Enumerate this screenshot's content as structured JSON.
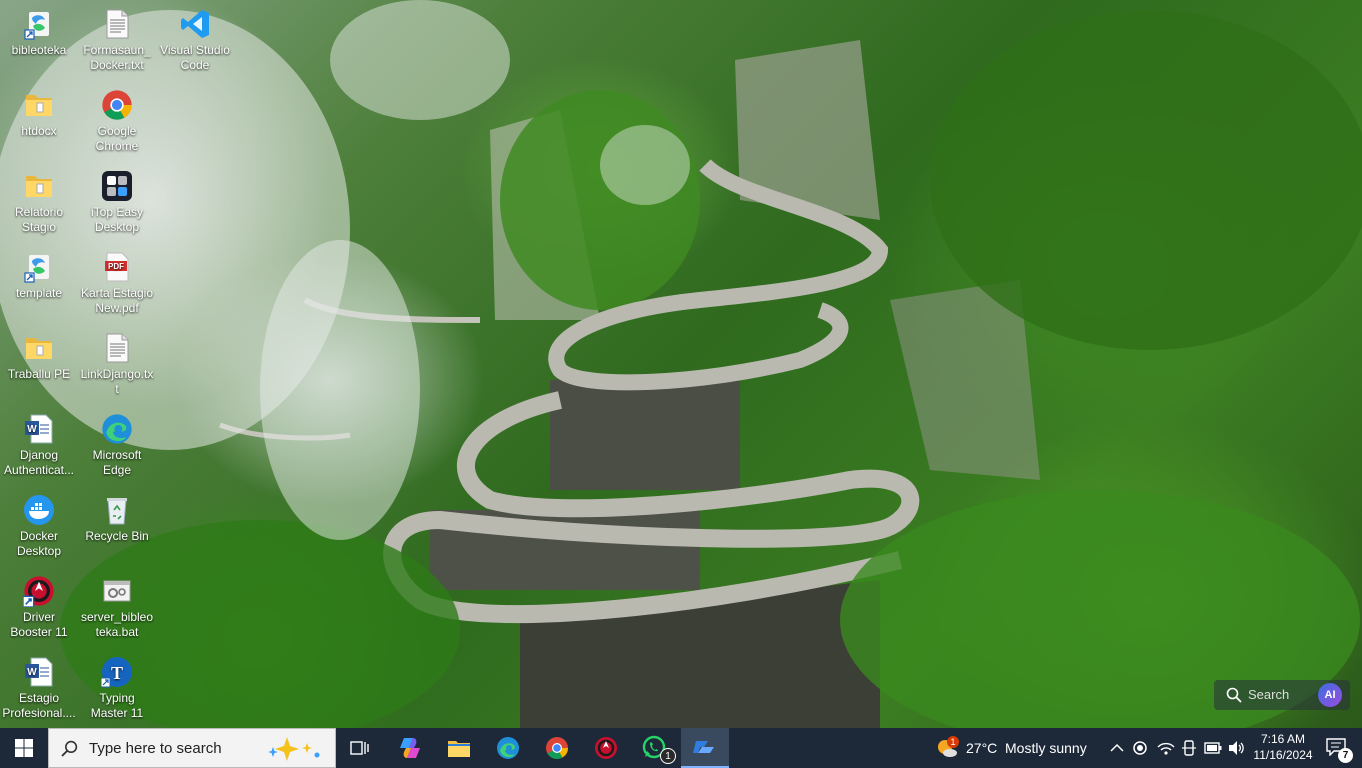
{
  "desktop": {
    "icons": [
      {
        "label": "bibleoteka",
        "icon": "app-shortcut-icon"
      },
      {
        "label": "Formasaun_Docker.txt",
        "icon": "text-file-icon"
      },
      {
        "label": "Visual Studio Code",
        "icon": "vscode-icon"
      },
      {
        "label": "htdocx",
        "icon": "folder-icon"
      },
      {
        "label": "Google Chrome",
        "icon": "chrome-icon"
      },
      {
        "label": "Relatorio Stagio",
        "icon": "folder-icon"
      },
      {
        "label": "iTop Easy Desktop",
        "icon": "itop-icon"
      },
      {
        "label": "template",
        "icon": "app-shortcut-icon"
      },
      {
        "label": "Karta Estagio New.pdf",
        "icon": "pdf-icon"
      },
      {
        "label": "Traballu PE",
        "icon": "folder-icon"
      },
      {
        "label": "LinkDjango.txt",
        "icon": "text-file-icon"
      },
      {
        "label": "Djanog Authenticat...",
        "icon": "word-icon"
      },
      {
        "label": "Microsoft Edge",
        "icon": "edge-icon"
      },
      {
        "label": "Docker Desktop",
        "icon": "docker-icon"
      },
      {
        "label": "Recycle Bin",
        "icon": "recycle-bin-icon"
      },
      {
        "label": "Driver Booster 11",
        "icon": "driver-booster-icon"
      },
      {
        "label": "server_bibleoteka.bat",
        "icon": "batch-file-icon"
      },
      {
        "label": "Estagio Profesional....",
        "icon": "word-icon"
      },
      {
        "label": "Typing Master 11",
        "icon": "typing-master-icon"
      }
    ],
    "widget_search": {
      "placeholder": "Search",
      "icon": "search-icon",
      "ai_badge": "AI"
    }
  },
  "taskbar": {
    "search_placeholder": "Type here to search",
    "apps": [
      {
        "name": "task-view",
        "icon": "task-view-icon"
      },
      {
        "name": "copilot",
        "icon": "copilot-icon"
      },
      {
        "name": "file-explorer",
        "icon": "folder-icon"
      },
      {
        "name": "edge",
        "icon": "edge-icon"
      },
      {
        "name": "chrome",
        "icon": "chrome-icon"
      },
      {
        "name": "driver-booster",
        "icon": "driver-booster-icon"
      },
      {
        "name": "whatsapp",
        "icon": "whatsapp-icon",
        "badge": "1"
      },
      {
        "name": "remote-app",
        "icon": "remote-icon",
        "active": true
      }
    ],
    "weather": {
      "badge": "1",
      "temp": "27°C",
      "condition": "Mostly sunny"
    },
    "clock": {
      "time": "7:16 AM",
      "date": "11/16/2024"
    },
    "notifications": {
      "count": "7"
    },
    "colors": {
      "taskbar_bg": "#1d2939",
      "accent": "#0078d4"
    }
  }
}
